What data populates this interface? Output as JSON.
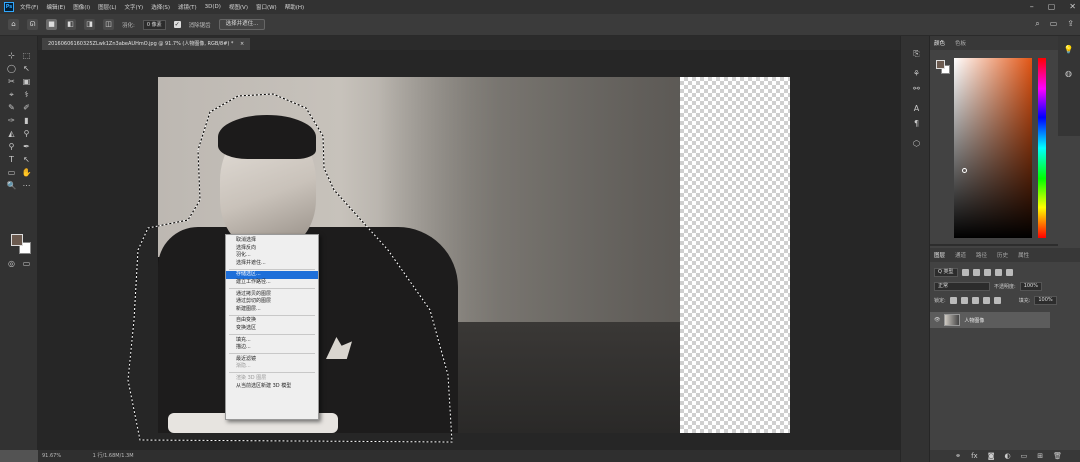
{
  "menubar": {
    "items": [
      "文件(F)",
      "编辑(E)",
      "图像(I)",
      "图层(L)",
      "文字(Y)",
      "选择(S)",
      "滤镜(T)",
      "3D(D)",
      "视图(V)",
      "窗口(W)",
      "帮助(H)"
    ],
    "logo_text": "Ps"
  },
  "options": {
    "feather_label": "羽化:",
    "feather_value": "0 像素",
    "antialias_label": "消除锯齿",
    "select_mask_label": "选择并遮住..."
  },
  "document": {
    "tab_title": "20160606160325ZLwk1Zn3abeAUHmO.jpg @ 91.7% (人物图像, RGB/8#) *",
    "close_glyph": "×"
  },
  "context_menu": {
    "groups": [
      [
        "取消选择",
        "选择反向",
        "羽化...",
        "选择并遮住..."
      ],
      [
        "存储选区...",
        "建立工作路径..."
      ],
      [
        "通过拷贝的图层",
        "通过剪切的图层",
        "新建图层..."
      ],
      [
        "自由变换",
        "变换选区"
      ],
      [
        "填充...",
        "描边..."
      ],
      [
        "最近滤镜",
        "渐隐..."
      ],
      [
        "渲染 3D 图层",
        "从当前选区新建 3D 模型"
      ]
    ],
    "highlighted": "存储选区...",
    "disabled": [
      "渐隐...",
      "渲染 3D 图层"
    ]
  },
  "status": {
    "zoom": "91.67%",
    "doc_size": "1 行/1.68M/1.3M"
  },
  "color_panel": {
    "tabs": [
      "颜色",
      "色板"
    ],
    "fg_color": "#6b5a4f",
    "bg_color": "#ffffff"
  },
  "layers_panel": {
    "tabs": [
      "图层",
      "通道",
      "路径",
      "历史",
      "属性"
    ],
    "filter_label": "Q 类型",
    "blend_mode": "正常",
    "opacity_label": "不透明度:",
    "opacity_value": "100%",
    "lock_label": "锁定:",
    "fill_label": "填充:",
    "fill_value": "100%",
    "layer_name": "人物图像",
    "visibility_glyph": "👁",
    "footer_icons": [
      "link-icon",
      "fx-icon",
      "mask-icon",
      "adjustment-icon",
      "group-icon",
      "new-layer-icon",
      "trash-icon"
    ]
  },
  "icons": {
    "home": "⌂",
    "search": "⌕",
    "tools": [
      "⬚",
      "⊹",
      "◯",
      "✂",
      "▣",
      "⌖",
      "✎",
      "⚕",
      "✐",
      "✑",
      "▮",
      "◭",
      "⚲",
      "✒",
      "T",
      "↖",
      "▭",
      "✋",
      "🔍",
      "⋯"
    ]
  }
}
